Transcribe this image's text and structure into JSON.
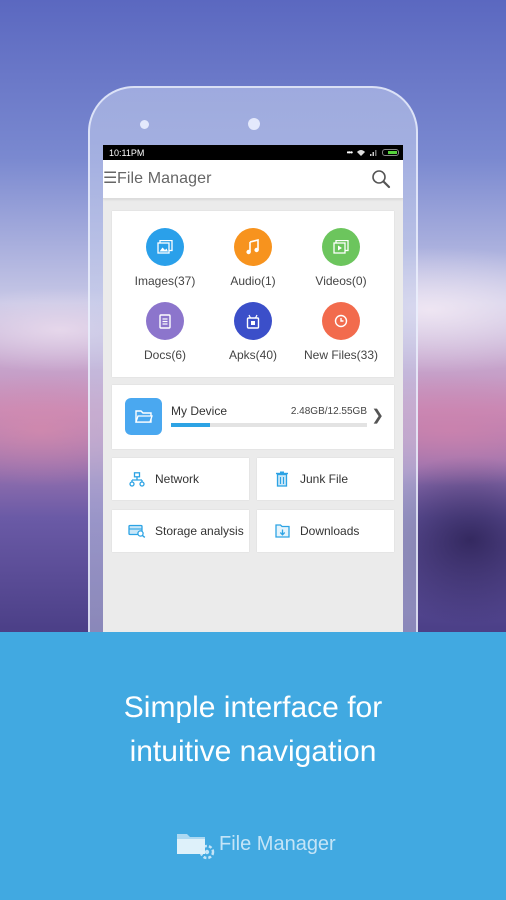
{
  "statusbar": {
    "time": "10:11PM",
    "icons": [
      "more-dots-icon",
      "wifi-icon",
      "signal-icon",
      "battery-icon"
    ]
  },
  "appbar": {
    "menu_icon": "hamburger-menu-icon",
    "title": "File Manager",
    "search_icon": "search-icon"
  },
  "categories": [
    {
      "label": "Images(37)",
      "icon": "image-icon",
      "color": "#2aa0ea"
    },
    {
      "label": "Audio(1)",
      "icon": "music-note-icon",
      "color": "#f7931e"
    },
    {
      "label": "Videos(0)",
      "icon": "video-icon",
      "color": "#6cc55d"
    },
    {
      "label": "Docs(6)",
      "icon": "document-icon",
      "color": "#8c75cc"
    },
    {
      "label": "Apks(40)",
      "icon": "android-package-icon",
      "color": "#3b4fc9"
    },
    {
      "label": "New Files(33)",
      "icon": "clock-icon",
      "color": "#f26b4d"
    }
  ],
  "device": {
    "name": "My Device",
    "usage": "2.48GB/12.55GB",
    "used_fraction": 0.198,
    "accent": "#2da3e4"
  },
  "tools": [
    {
      "label": "Network",
      "icon": "network-icon"
    },
    {
      "label": "Junk File",
      "icon": "trash-icon"
    },
    {
      "label": "Storage analysis",
      "icon": "storage-analysis-icon"
    },
    {
      "label": "Downloads",
      "icon": "download-folder-icon"
    }
  ],
  "promo": {
    "line1": "Simple interface for",
    "line2": "intuitive navigation",
    "brand_name": "File Manager",
    "background": "#41a9e1"
  }
}
